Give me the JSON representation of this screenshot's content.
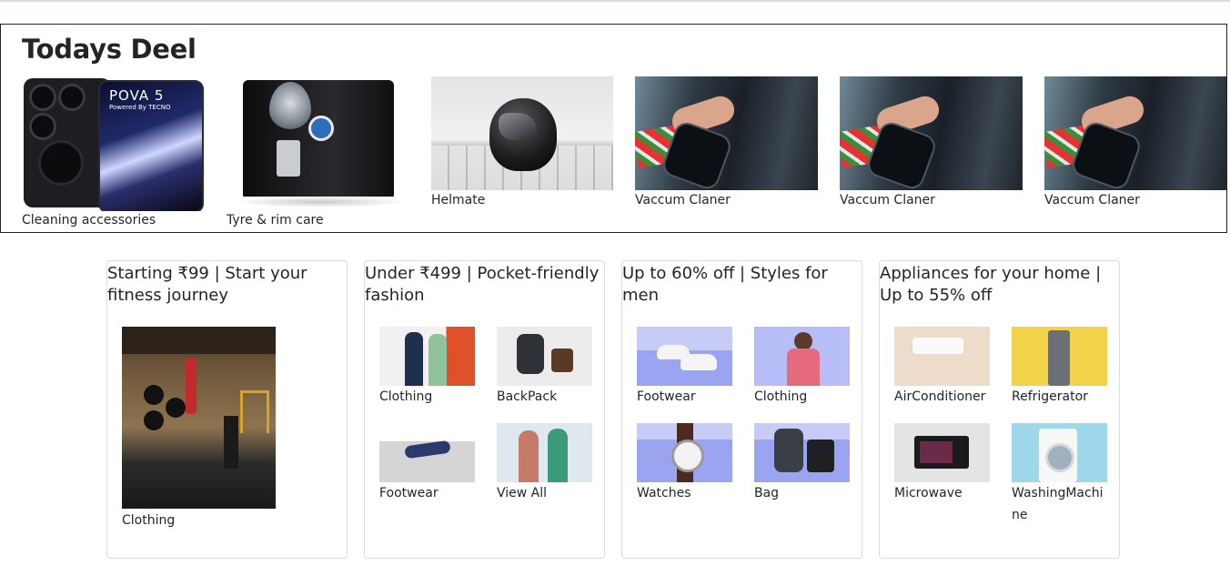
{
  "deal": {
    "title": "Todays Deel",
    "items": [
      {
        "caption": "Cleaning accessories",
        "icon": "phone-image"
      },
      {
        "caption": "Tyre & rim care",
        "icon": "water-purifier-image"
      },
      {
        "caption": "Helmate",
        "icon": "helmet-image"
      },
      {
        "caption": "Vaccum Claner",
        "icon": "vacuum-image"
      },
      {
        "caption": "Vaccum Claner",
        "icon": "vacuum-image"
      },
      {
        "caption": "Vaccum Claner",
        "icon": "vacuum-image"
      }
    ],
    "phone_brand": "POVA 5",
    "phone_sub": "Powered By TECNO"
  },
  "cards": [
    {
      "title": "Starting ₹99 | Start your fitness journey",
      "tiles": [
        {
          "caption": "Clothing",
          "icon": "gym-image"
        }
      ]
    },
    {
      "title": "Under ₹499 | Pocket-friendly fashion",
      "tiles": [
        {
          "caption": "Clothing",
          "icon": "couple-clothing-image"
        },
        {
          "caption": "BackPack",
          "icon": "backpack-image"
        },
        {
          "caption": "Footwear",
          "icon": "sandals-image"
        },
        {
          "caption": "View All",
          "icon": "people-image"
        }
      ]
    },
    {
      "title": "Up to 60% off | Styles for men",
      "tiles": [
        {
          "caption": "Footwear",
          "icon": "sneakers-image"
        },
        {
          "caption": "Clothing",
          "icon": "man-clothing-image"
        },
        {
          "caption": "Watches",
          "icon": "watch-image"
        },
        {
          "caption": "Bag",
          "icon": "bag-image"
        }
      ]
    },
    {
      "title": "Appliances for your home | Up to 55% off",
      "tiles": [
        {
          "caption": "AirConditioner",
          "icon": "air-conditioner-image"
        },
        {
          "caption": "Refrigerator",
          "icon": "refrigerator-image"
        },
        {
          "caption": "Microwave",
          "icon": "microwave-image"
        },
        {
          "caption": "WashingMachine",
          "icon": "washing-machine-image"
        }
      ]
    }
  ]
}
